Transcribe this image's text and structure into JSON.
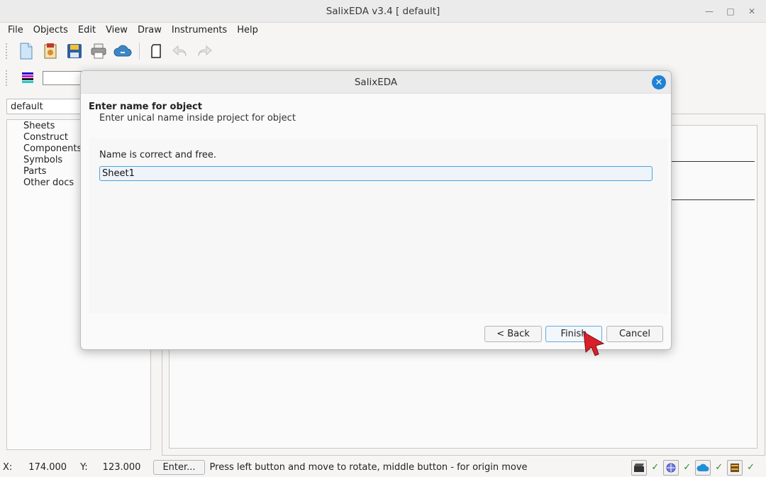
{
  "window": {
    "title": "SalixEDA v3.4 [ default]"
  },
  "menu": [
    "File",
    "Objects",
    "Edit",
    "View",
    "Draw",
    "Instruments",
    "Help"
  ],
  "toolbar": {
    "icons": [
      "new-document-icon",
      "open-project-icon",
      "save-icon",
      "print-icon",
      "cloud-icon",
      "page-icon",
      "undo-icon",
      "redo-icon"
    ]
  },
  "project": {
    "selected": "default"
  },
  "tree": [
    "Sheets",
    "Construct",
    "Components",
    "Symbols",
    "Parts",
    "Other docs"
  ],
  "status": {
    "x_label": "X:",
    "x_value": "174.000",
    "y_label": "Y:",
    "y_value": "123.000",
    "enter_button": "Enter...",
    "message": "Press left button and move to rotate, middle button - for origin move",
    "checks": [
      "✓",
      "✓",
      "✓",
      "✓"
    ]
  },
  "dialog": {
    "title": "SalixEDA",
    "heading": "Enter name for object",
    "subheading": "Enter unical name inside project for object",
    "message": "Name is correct and free.",
    "name_value": "Sheet1",
    "back_label": "< Back",
    "finish_label": "Finish",
    "cancel_label": "Cancel"
  },
  "colors": {
    "accent": "#1f82d4",
    "input_border": "#4aa3df"
  }
}
